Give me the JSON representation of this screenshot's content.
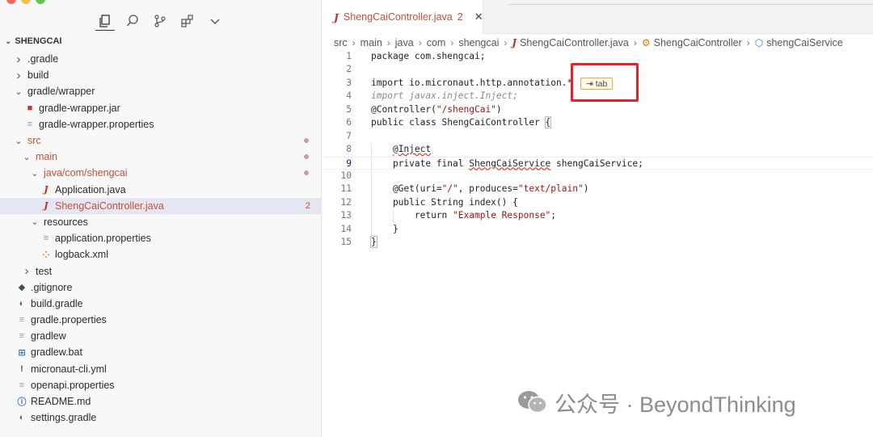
{
  "colors": {
    "git_modified": "#c74e39",
    "highlight_border": "#e8202a",
    "selection": "#e4e6f1"
  },
  "sidebar": {
    "project_name": "SHENGCAI",
    "items": [
      {
        "label": ".gradle",
        "type": "folder",
        "state": "collapsed",
        "level": 1,
        "modified": false
      },
      {
        "label": "build",
        "type": "folder",
        "state": "collapsed",
        "level": 1,
        "modified": false
      },
      {
        "label": "gradle/wrapper",
        "type": "folder",
        "state": "expanded",
        "level": 1,
        "modified": false
      },
      {
        "label": "gradle-wrapper.jar",
        "type": "jar",
        "level": 2,
        "modified": false
      },
      {
        "label": "gradle-wrapper.properties",
        "type": "text",
        "level": 2,
        "modified": false
      },
      {
        "label": "src",
        "type": "folder",
        "state": "expanded",
        "level": 1,
        "modified": true,
        "dot": true
      },
      {
        "label": "main",
        "type": "folder",
        "state": "expanded",
        "level": 2,
        "modified": true,
        "dot": true
      },
      {
        "label": "java/com/shengcai",
        "type": "folder",
        "state": "expanded",
        "level": 3,
        "modified": true,
        "dot": true
      },
      {
        "label": "Application.java",
        "type": "java",
        "level": 4,
        "modified": false
      },
      {
        "label": "ShengCaiController.java",
        "type": "java",
        "level": 4,
        "modified": true,
        "badge": "2",
        "selected": true
      },
      {
        "label": "resources",
        "type": "folder",
        "state": "expanded",
        "level": 3,
        "modified": false
      },
      {
        "label": "application.properties",
        "type": "text",
        "level": 4,
        "modified": false
      },
      {
        "label": "logback.xml",
        "type": "xml",
        "level": 4,
        "modified": false
      },
      {
        "label": "test",
        "type": "folder",
        "state": "collapsed",
        "level": 2,
        "modified": false
      },
      {
        "label": ".gitignore",
        "type": "git",
        "level": 1,
        "modified": false
      },
      {
        "label": "build.gradle",
        "type": "gradle",
        "level": 1,
        "modified": false
      },
      {
        "label": "gradle.properties",
        "type": "text",
        "level": 1,
        "modified": false
      },
      {
        "label": "gradlew",
        "type": "text",
        "level": 1,
        "modified": false
      },
      {
        "label": "gradlew.bat",
        "type": "windows",
        "level": 1,
        "modified": false
      },
      {
        "label": "micronaut-cli.yml",
        "type": "yaml",
        "level": 1,
        "modified": false
      },
      {
        "label": "openapi.properties",
        "type": "text",
        "level": 1,
        "modified": false
      },
      {
        "label": "README.md",
        "type": "info",
        "level": 1,
        "modified": false
      },
      {
        "label": "settings.gradle",
        "type": "gradle",
        "level": 1,
        "modified": false
      }
    ]
  },
  "editor": {
    "tab": {
      "icon": "J",
      "label": "ShengCaiController.java",
      "badge": "2"
    },
    "breadcrumb": [
      "src",
      "main",
      "java",
      "com",
      "shengcai",
      "ShengCaiController.java",
      "ShengCaiController",
      "shengCaiService"
    ],
    "code_lines": [
      {
        "num": "1",
        "text": "package com.shengcai;"
      },
      {
        "num": "2",
        "text": ""
      },
      {
        "num": "3",
        "text": "import io.micronaut.http.annotation.*"
      },
      {
        "num": "4",
        "text": "import javax.inject.Inject;",
        "ghost": true
      },
      {
        "num": "5",
        "text": "@Controller(\"/shengCai\")"
      },
      {
        "num": "6",
        "text": "public class ShengCaiController {"
      },
      {
        "num": "7",
        "text": ""
      },
      {
        "num": "8",
        "text": "    @Inject"
      },
      {
        "num": "9",
        "text": "    private final ShengCaiService shengCaiService;"
      },
      {
        "num": "10",
        "text": ""
      },
      {
        "num": "11",
        "text": "    @Get(uri=\"/\", produces=\"text/plain\")"
      },
      {
        "num": "12",
        "text": "    public String index() {"
      },
      {
        "num": "13",
        "text": "        return \"Example Response\";"
      },
      {
        "num": "14",
        "text": "    }"
      },
      {
        "num": "15",
        "text": "}"
      }
    ],
    "tab_hint": "⇥ tab",
    "active_line": "9"
  },
  "watermark": {
    "text": "公众号 · BeyondThinking"
  }
}
